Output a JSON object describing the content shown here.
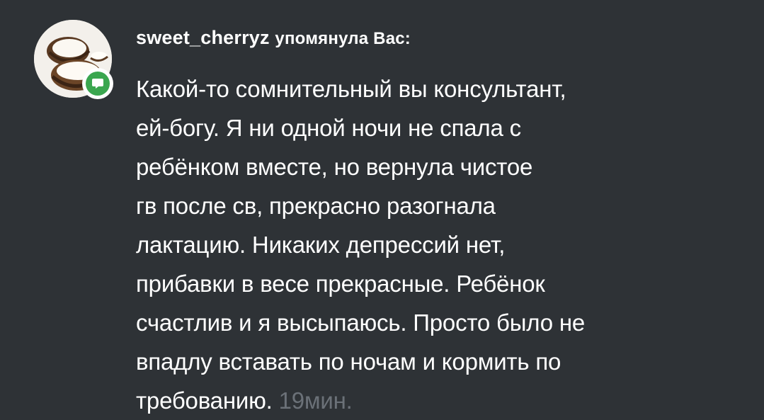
{
  "notification": {
    "username": "sweet_cherryz",
    "action": "упомянула Вас:",
    "message": "Какой-то сомнительный вы консультант,\nей-богу. Я ни одной ночи не спала с\nребёнком вместе, но вернула чистое\nгв после св, прекрасно разогнала\nлактацию. Никаких депрессий нет,\nприбавки в весе прекрасные. Ребёнок\nсчастлив и я высыпаюсь. Просто было не\nвпадлу вставать по ночам и кормить по\nтребованию.",
    "time": "19мин.",
    "avatar_icon": "coconut-photo",
    "badge_icon": "comment-icon"
  },
  "colors": {
    "background": "#2e3236",
    "text": "#ffffff",
    "timestamp": "#6b7178",
    "badge": "#3aa64f"
  }
}
